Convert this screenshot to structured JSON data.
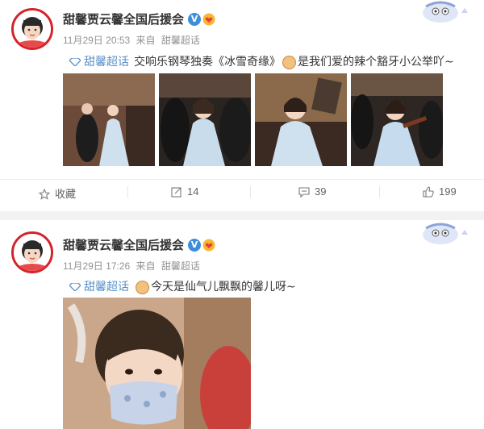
{
  "posts": [
    {
      "author": "甜馨贾云馨全国后援会",
      "verified_badge": "V",
      "date": "11月29日 20:53",
      "source_prefix": "来自",
      "source": "甜馨超话",
      "topic": "甜馨超话",
      "text_before_emoji": "交响乐钢琴独奏《冰雪奇缘》",
      "text_after_emoji": "是我们爱的辣个豁牙小公举吖~",
      "actions": {
        "favorite_label": "收藏",
        "repost_count": "14",
        "comment_count": "39",
        "like_count": "199"
      }
    },
    {
      "author": "甜馨贾云馨全国后援会",
      "verified_badge": "V",
      "date": "11月29日 17:26",
      "source_prefix": "来自",
      "source": "甜馨超话",
      "topic": "甜馨超话",
      "text_before_emoji": "",
      "text_after_emoji": "今天是仙气儿飘飘的馨儿呀~"
    }
  ],
  "icons": {
    "verified": "verified-v-icon",
    "fan_badge": "heart-badge-icon",
    "topic": "diamond-topic-icon",
    "favorite": "star-icon",
    "repost": "repost-icon",
    "comment": "comment-icon",
    "like": "thumbs-up-icon"
  },
  "colors": {
    "link": "#5a91c9",
    "meta": "#939393",
    "verified": "#3b8fd9",
    "avatar_ring": "#d4232b"
  }
}
